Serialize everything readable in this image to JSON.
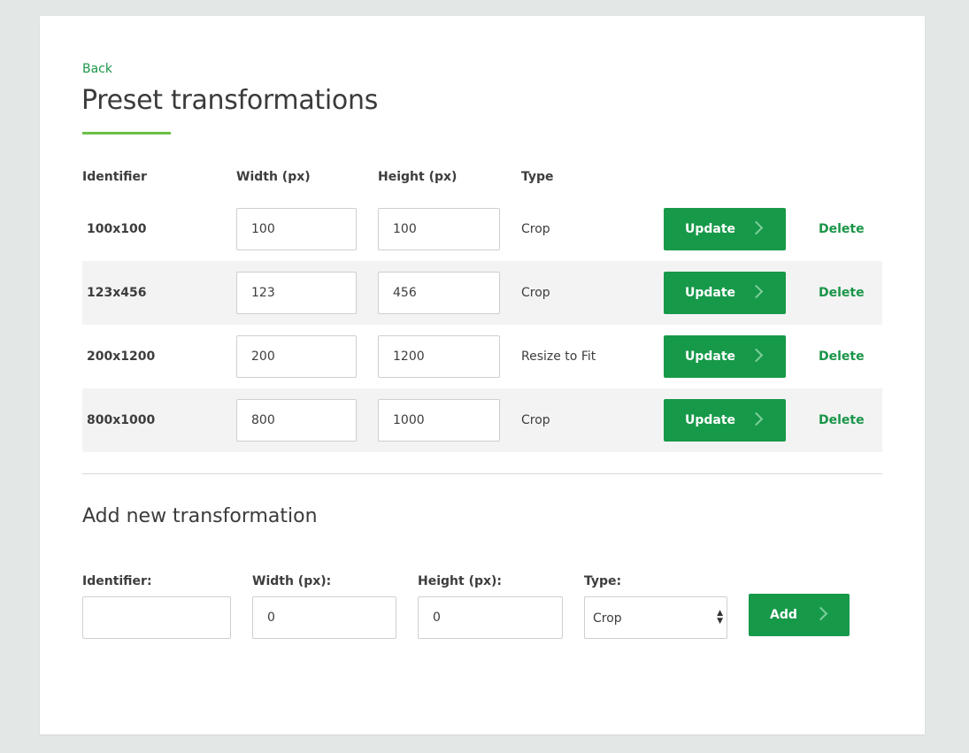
{
  "page": {
    "back_label": "Back",
    "title": "Preset transformations"
  },
  "table": {
    "headers": [
      "Identifier",
      "Width (px)",
      "Height (px)",
      "Type"
    ],
    "rows": [
      {
        "identifier": "100x100",
        "width": "100",
        "height": "100",
        "type": "Crop"
      },
      {
        "identifier": "123x456",
        "width": "123",
        "height": "456",
        "type": "Crop"
      },
      {
        "identifier": "200x1200",
        "width": "200",
        "height": "1200",
        "type": "Resize to Fit"
      },
      {
        "identifier": "800x1000",
        "width": "800",
        "height": "1000",
        "type": "Crop"
      }
    ],
    "update_label": "Update",
    "delete_label": "Delete"
  },
  "add_form": {
    "title": "Add new transformation",
    "identifier_label": "Identifier:",
    "identifier_value": "",
    "width_label": "Width (px):",
    "width_value": "0",
    "height_label": "Height (px):",
    "height_value": "0",
    "type_label": "Type:",
    "type_value": "Crop",
    "add_label": "Add"
  },
  "colors": {
    "accent": "#17994a",
    "link": "#1a9548",
    "underline": "#6cbf45",
    "background": "#e3e7e5",
    "row_alt": "#f3f3f3"
  },
  "icons": {
    "button_chevron": "chevron-right-icon",
    "select_arrows": "select-arrows-icon"
  }
}
